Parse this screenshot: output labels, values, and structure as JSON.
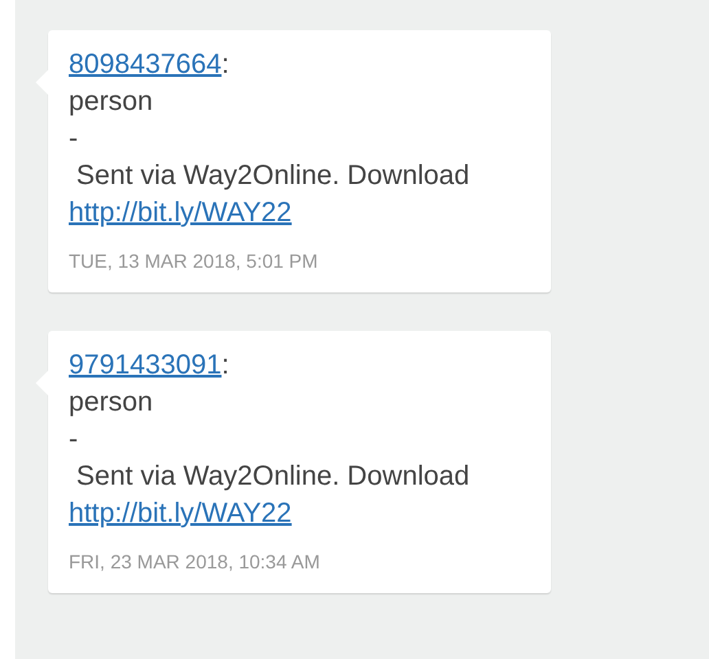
{
  "messages": [
    {
      "sender": "8098437664",
      "separator": ":",
      "lines": [
        "person",
        "-",
        " Sent via Way2Online. Download"
      ],
      "link": "http://bit.ly/WAY22",
      "timestamp": "TUE, 13 MAR 2018, 5:01 PM"
    },
    {
      "sender": "9791433091",
      "separator": ":",
      "lines": [
        "person",
        "-",
        " Sent via Way2Online. Download"
      ],
      "link": "http://bit.ly/WAY22",
      "timestamp": "FRI, 23 MAR 2018, 10:34 AM"
    }
  ]
}
